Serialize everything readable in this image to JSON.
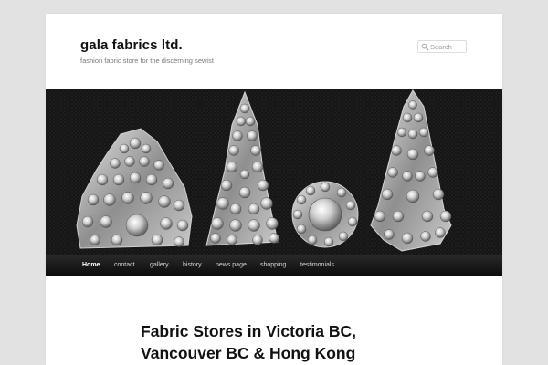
{
  "site": {
    "title": "gala fabrics ltd.",
    "description": "fashion fabric store for the discerning sewist"
  },
  "search": {
    "placeholder": "Search",
    "icon": "search-icon"
  },
  "header_image": {
    "icon": "jewelled-buttons-photo"
  },
  "nav": {
    "items": [
      {
        "label": "Home",
        "active": true
      },
      {
        "label": "contact"
      },
      {
        "label": "gallery"
      },
      {
        "label": "history"
      },
      {
        "label": "news page"
      },
      {
        "label": "shopping"
      },
      {
        "label": "testimonials"
      }
    ]
  },
  "main": {
    "title_line1": "Fabric Stores in Victoria BC,",
    "title_line2": "Vancouver BC & Hong Kong"
  },
  "colors": {
    "background": "#e2e2e2",
    "page": "#ffffff",
    "nav_bar": "#1a1a1a",
    "nav_text": "#d8d8d8"
  }
}
